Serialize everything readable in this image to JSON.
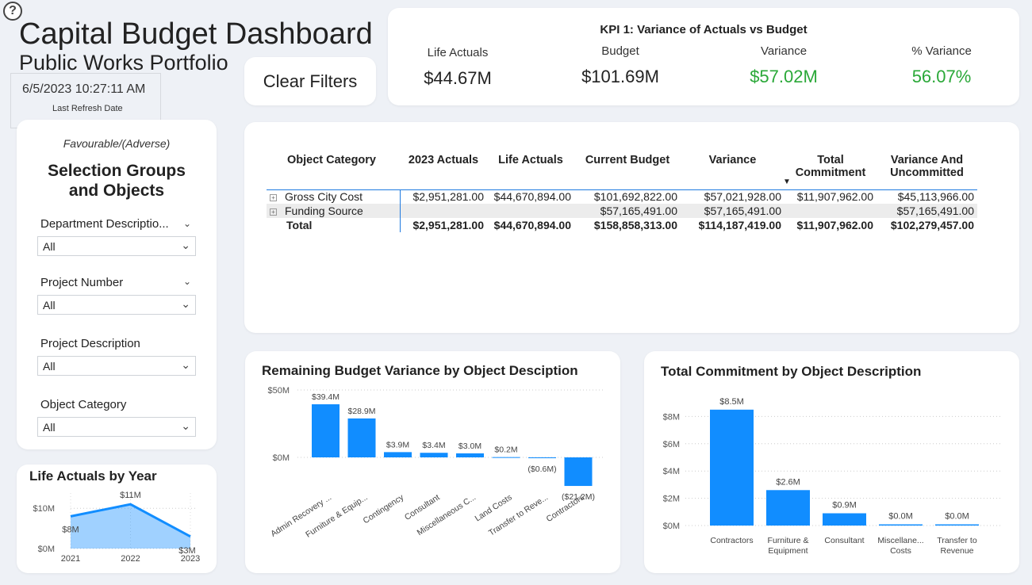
{
  "header": {
    "help_glyph": "?",
    "title": "Capital Budget Dashboard",
    "subtitle": "Public Works Portfolio",
    "refresh_date": "6/5/2023 10:27:11 AM",
    "refresh_label": "Last Refresh Date",
    "clear_filters": "Clear Filters"
  },
  "kpi": {
    "title": "KPI 1: Variance of Actuals vs Budget",
    "items": [
      {
        "label": "Life Actuals",
        "value": "$44.67M"
      },
      {
        "label": "Budget",
        "value": "$101.69M"
      },
      {
        "label": "Variance",
        "value": "$57.02M"
      },
      {
        "label": "% Variance",
        "value": "56.07%"
      }
    ],
    "positive_color": "#2aa838"
  },
  "slicers": {
    "heading": "Favourable/(Adverse)",
    "title_line1": "Selection Groups",
    "title_line2": "and Objects",
    "items": [
      {
        "label": "Department Descriptio...",
        "value": "All"
      },
      {
        "label": "Project Number",
        "value": "All"
      },
      {
        "label": "Project Description",
        "value": "All"
      },
      {
        "label": "Object Category",
        "value": "All"
      }
    ]
  },
  "matrix": {
    "headers": [
      "Object Category",
      "2023 Actuals",
      "Life Actuals",
      "Current Budget",
      "Variance",
      "Total Commitment",
      "Variance And Uncommitted"
    ],
    "rows": [
      [
        "Gross City Cost",
        "$2,951,281.00",
        "$44,670,894.00",
        "$101,692,822.00",
        "$57,021,928.00",
        "$11,907,962.00",
        "$45,113,966.00"
      ],
      [
        "Funding Source",
        "",
        "",
        "$57,165,491.00",
        "$57,165,491.00",
        "",
        "$57,165,491.00"
      ],
      [
        "Total",
        "$2,951,281.00",
        "$44,670,894.00",
        "$158,858,313.00",
        "$114,187,419.00",
        "$11,907,962.00",
        "$102,279,457.00"
      ]
    ],
    "expand_glyph": "+",
    "sort_glyph": "▼"
  },
  "chart_data": [
    {
      "type": "area",
      "title": "Life Actuals by Year",
      "categories": [
        "2021",
        "2022",
        "2023"
      ],
      "values": [
        8,
        11,
        3
      ],
      "data_labels": [
        "$8M",
        "$11M",
        "$3M"
      ],
      "y_ticks": [
        "$0M",
        "$10M"
      ],
      "ylim": [
        0,
        13
      ],
      "color": "#118dff"
    },
    {
      "type": "bar",
      "title": "Remaining Budget Variance by Object Desciption",
      "categories": [
        "Admin Recovery ...",
        "Furniture & Equip...",
        "Contingency",
        "Consultant",
        "Miscellaneous C...",
        "Land Costs",
        "Transfer to Reve...",
        "Contractors"
      ],
      "values": [
        39.4,
        28.9,
        3.9,
        3.4,
        3.0,
        0.2,
        -0.6,
        -21.2
      ],
      "data_labels": [
        "$39.4M",
        "$28.9M",
        "$3.9M",
        "$3.4M",
        "$3.0M",
        "$0.2M",
        "($0.6M)",
        "($21.2M)"
      ],
      "y_ticks": [
        "$0M",
        "$50M"
      ],
      "ylim": [
        -30,
        55
      ],
      "color": "#118dff"
    },
    {
      "type": "bar",
      "title": "Total Commitment by Object Description",
      "categories": [
        "Contractors",
        "Furniture & Equipment",
        "Consultant",
        "Miscellane... Costs",
        "Transfer to Revenue"
      ],
      "category_lines": [
        [
          "Contractors"
        ],
        [
          "Furniture &",
          "Equipment"
        ],
        [
          "Consultant"
        ],
        [
          "Miscellane...",
          "Costs"
        ],
        [
          "Transfer to",
          "Revenue"
        ]
      ],
      "values": [
        8.5,
        2.6,
        0.9,
        0.0,
        0.0
      ],
      "data_labels": [
        "$8.5M",
        "$2.6M",
        "$0.9M",
        "$0.0M",
        "$0.0M"
      ],
      "y_ticks": [
        "$0M",
        "$2M",
        "$4M",
        "$6M",
        "$8M"
      ],
      "ylim": [
        0,
        9
      ],
      "color": "#118dff"
    }
  ]
}
